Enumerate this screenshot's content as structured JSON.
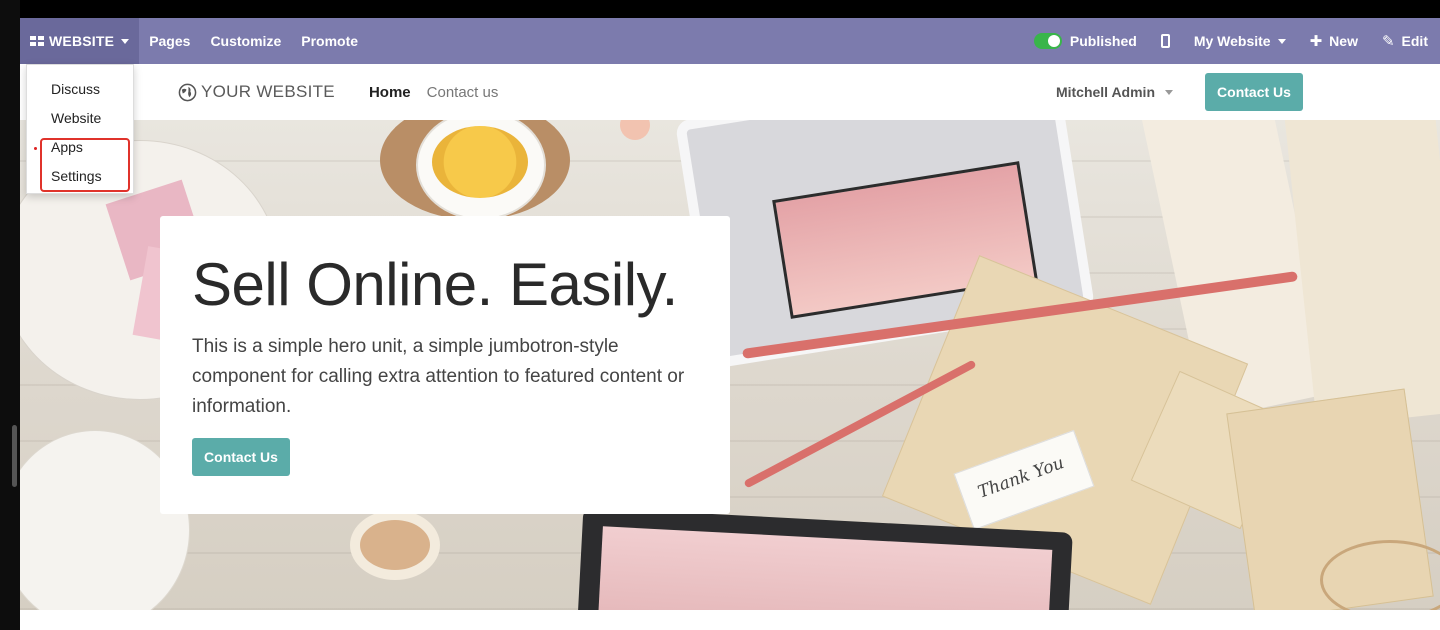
{
  "topbar": {
    "app_label": "WEBSITE",
    "links": [
      "Pages",
      "Customize",
      "Promote"
    ],
    "published_label": "Published",
    "site_switch_label": "My Website",
    "new_label": "New",
    "edit_label": "Edit"
  },
  "app_dropdown": {
    "items": [
      "Discuss",
      "Website",
      "Apps",
      "Settings"
    ]
  },
  "site_header": {
    "logo_text": "YOUR WEBSITE",
    "nav": [
      "Home",
      "Contact us"
    ],
    "user_name": "Mitchell Admin",
    "cta_label": "Contact Us"
  },
  "hero": {
    "title": "Sell Online. Easily.",
    "text": "This is a simple hero unit, a simple jumbotron-style component for calling extra attention to featured content or information.",
    "cta_label": "Contact Us",
    "tag_text": "Thank You"
  },
  "colors": {
    "topbar": "#7c7bad",
    "app_menu": "#6a699b",
    "teal_button": "#5baca9",
    "published_toggle": "#39b54a",
    "highlight_box": "#e0332b"
  }
}
